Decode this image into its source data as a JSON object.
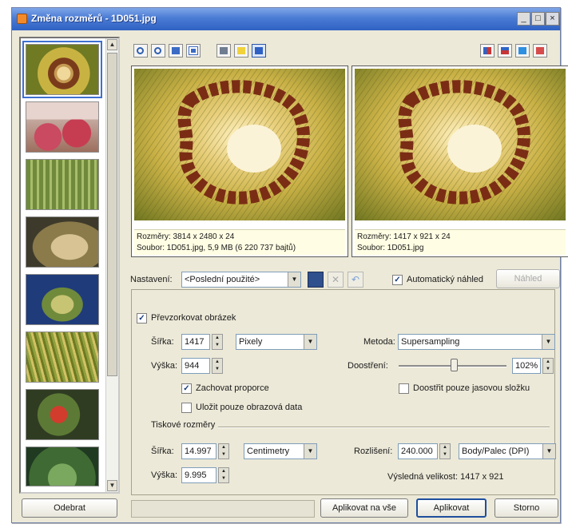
{
  "window": {
    "title": "Změna rozměrů - 1D051.jpg",
    "controls": [
      "_",
      "□",
      "×"
    ]
  },
  "thumbnails": {
    "items": [
      "thumb-sunflower-cactus",
      "thumb-red-fruits",
      "thumb-cactus-column",
      "thumb-fuzzy-cactus",
      "thumb-flowering-cactus",
      "thumb-cactus-spines",
      "thumb-red-flowers",
      "thumb-green-plant"
    ],
    "remove_button": "Odebrat"
  },
  "toolbar": {
    "left_icons": [
      "zoom-in-icon",
      "zoom-out-icon",
      "fit-icon",
      "actual-size-icon",
      "compare-icon",
      "highlight-icon",
      "info-icon"
    ],
    "right_icons": [
      "split-vertical-icon",
      "split-horizontal-icon",
      "single-view-icon",
      "close-view-icon"
    ]
  },
  "preview": {
    "original": {
      "line1": "Rozměry: 3814 x 2480 x 24",
      "line2": "Soubor: 1D051.jpg, 5,9 MB (6 220 737 bajtů)"
    },
    "result": {
      "line1": "Rozměry: 1417 x 921 x 24",
      "line2": "Soubor: 1D051.jpg"
    }
  },
  "presets": {
    "label": "Nastavení:",
    "value": "<Poslední použité>",
    "auto_preview_label": "Automatický náhled",
    "auto_preview_checked": true,
    "preview_button": "Náhled"
  },
  "resize": {
    "resample_label": "Převzorkovat obrázek",
    "resample_checked": true,
    "width_label": "Šířka:",
    "width_value": "1417",
    "width_unit": "Pixely",
    "height_label": "Výška:",
    "height_value": "944",
    "keep_ratio_label": "Zachovat proporce",
    "keep_ratio_checked": true,
    "image_data_only_label": "Uložit pouze obrazová data",
    "image_data_only_checked": false,
    "method_label": "Metoda:",
    "method_value": "Supersampling",
    "sharpen_label": "Doostření:",
    "sharpen_value": "102%",
    "sharpen_level": 0.51,
    "sharpen_luma_label": "Doostřit pouze jasovou složku",
    "sharpen_luma_checked": false
  },
  "print_size": {
    "group_label": "Tiskové rozměry",
    "width_label": "Šířka:",
    "width_value": "14.997",
    "unit_value": "Centimetry",
    "height_label": "Výška:",
    "height_value": "9.995",
    "resolution_label": "Rozlišení:",
    "resolution_value": "240.000",
    "resolution_unit": "Body/Palec (DPI)",
    "result_size": "Výsledná velikost: 1417 x 921"
  },
  "footer": {
    "apply_all": "Aplikovat na vše",
    "apply": "Aplikovat",
    "cancel": "Storno"
  }
}
